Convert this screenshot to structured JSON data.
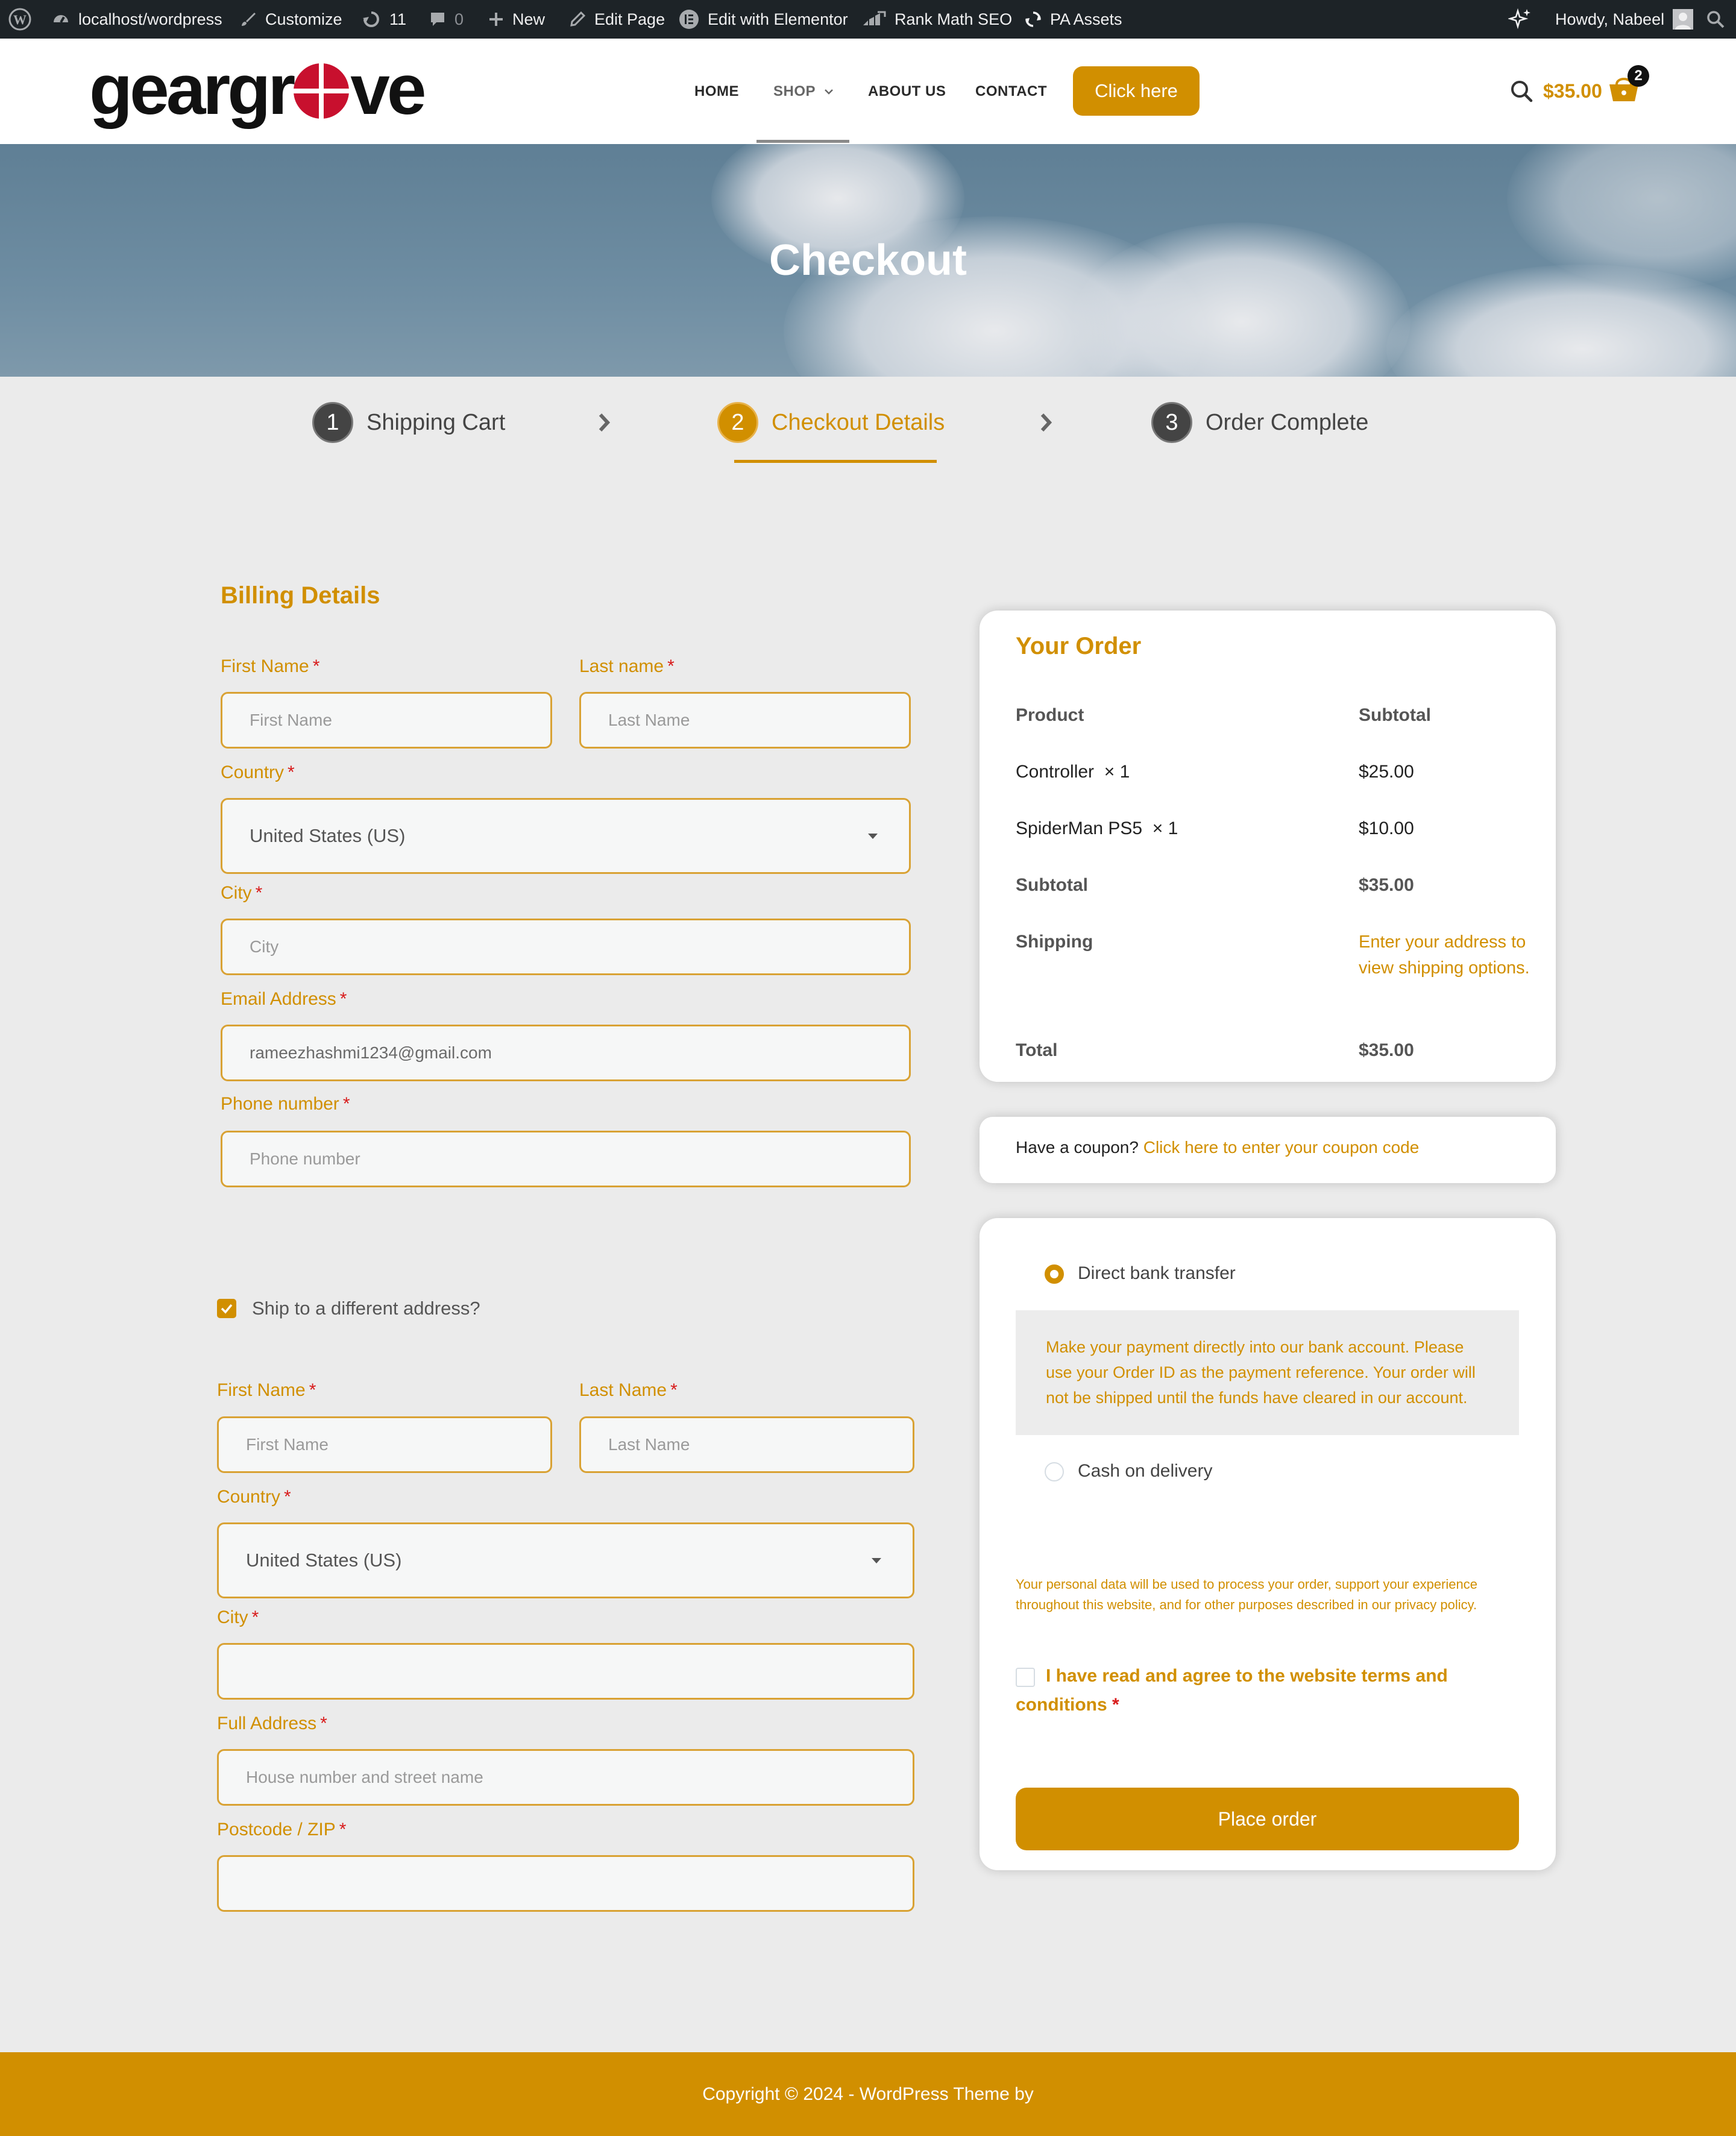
{
  "admin_bar": {
    "site": "localhost/wordpress",
    "customize": "Customize",
    "updates_count": "11",
    "comments_count": "0",
    "new": "New",
    "edit_page": "Edit Page",
    "edit_elementor": "Edit with Elementor",
    "rank_math": "Rank Math SEO",
    "pa_assets": "PA Assets",
    "howdy": "Howdy, Nabeel"
  },
  "header": {
    "logo_left": "geargr",
    "logo_right": "ve",
    "nav": [
      "HOME",
      "SHOP",
      "ABOUT US",
      "CONTACT"
    ],
    "cta": "Click here",
    "cart_total": "$35.00",
    "cart_count": "2"
  },
  "hero": {
    "title": "Checkout"
  },
  "steps": [
    {
      "num": "1",
      "label": "Shipping Cart"
    },
    {
      "num": "2",
      "label": "Checkout Details"
    },
    {
      "num": "3",
      "label": "Order Complete"
    }
  ],
  "billing": {
    "title": "Billing Details",
    "first_name_label": "First Name",
    "first_name_placeholder": "First Name",
    "last_name_label": "Last name",
    "last_name_placeholder": "Last Name",
    "country_label": "Country",
    "country_value": "United States (US)",
    "city_label": "City",
    "city_placeholder": "City",
    "email_label": "Email Address",
    "email_value": "rameezhashmi1234@gmail.com",
    "phone_label": "Phone number",
    "phone_placeholder": "Phone number",
    "required_mark": "*"
  },
  "shipping": {
    "ship_diff_label": "Ship to a different address?",
    "first_name_label": "First Name",
    "first_name_placeholder": "First Name",
    "last_name_label": "Last Name",
    "last_name_placeholder": "Last Name",
    "country_label": "Country",
    "country_value": "United States (US)",
    "city_label": "City",
    "address_label": "Full Address",
    "address_placeholder": "House number and street name",
    "postcode_label": "Postcode / ZIP"
  },
  "order": {
    "title": "Your Order",
    "col_product": "Product",
    "col_subtotal": "Subtotal",
    "items": [
      {
        "name": "Controller  × 1",
        "price": "$25.00"
      },
      {
        "name": "SpiderMan PS5  × 1",
        "price": "$10.00"
      }
    ],
    "subtotal_label": "Subtotal",
    "subtotal_value": "$35.00",
    "shipping_label": "Shipping",
    "shipping_note": "Enter your address to view shipping options.",
    "total_label": "Total",
    "total_value": "$35.00"
  },
  "coupon": {
    "text": "Have a coupon?",
    "link": "Click here to enter your coupon code"
  },
  "payment": {
    "bank_label": "Direct bank transfer",
    "bank_desc": "Make your payment directly into our bank account. Please use your Order ID as the payment reference. Your order will not be shipped until the funds have cleared in our account.",
    "cod_label": "Cash on delivery",
    "privacy": "Your personal data will be used to process your order, support your experience throughout this website, and for other purposes described in our privacy policy.",
    "terms": "I have read and agree to the website terms and conditions",
    "place_order": "Place order"
  },
  "footer": {
    "text": "Copyright © 2024 - WordPress Theme by"
  },
  "colors": {
    "accent": "#d18f00",
    "admin_bar": "#1d2327",
    "required": "#d81b1b"
  }
}
